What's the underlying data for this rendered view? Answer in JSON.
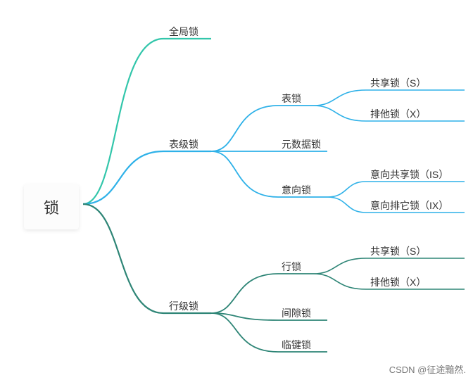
{
  "root": {
    "label": "锁"
  },
  "branches": {
    "global": {
      "label": "全局锁",
      "color": "#33c6ab"
    },
    "table": {
      "label": "表级锁",
      "color": "#2eb1e8",
      "children": {
        "tableLock": {
          "label": "表锁",
          "children": {
            "shared": {
              "label": "共享锁（S）"
            },
            "exclusive": {
              "label": "排他锁（X）"
            }
          }
        },
        "metaLock": {
          "label": "元数据锁"
        },
        "intentLock": {
          "label": "意向锁",
          "children": {
            "is": {
              "label": "意向共享锁（IS）"
            },
            "ix": {
              "label": "意向排它锁（IX）"
            }
          }
        }
      }
    },
    "row": {
      "label": "行级锁",
      "color": "#2e8576",
      "children": {
        "rowLock": {
          "label": "行锁",
          "children": {
            "shared": {
              "label": "共享锁（S）"
            },
            "exclusive": {
              "label": "排他锁（X）"
            }
          }
        },
        "gapLock": {
          "label": "间隙锁"
        },
        "nextKeyLock": {
          "label": "临键锁"
        }
      }
    }
  },
  "watermark": "CSDN @征途黯然."
}
